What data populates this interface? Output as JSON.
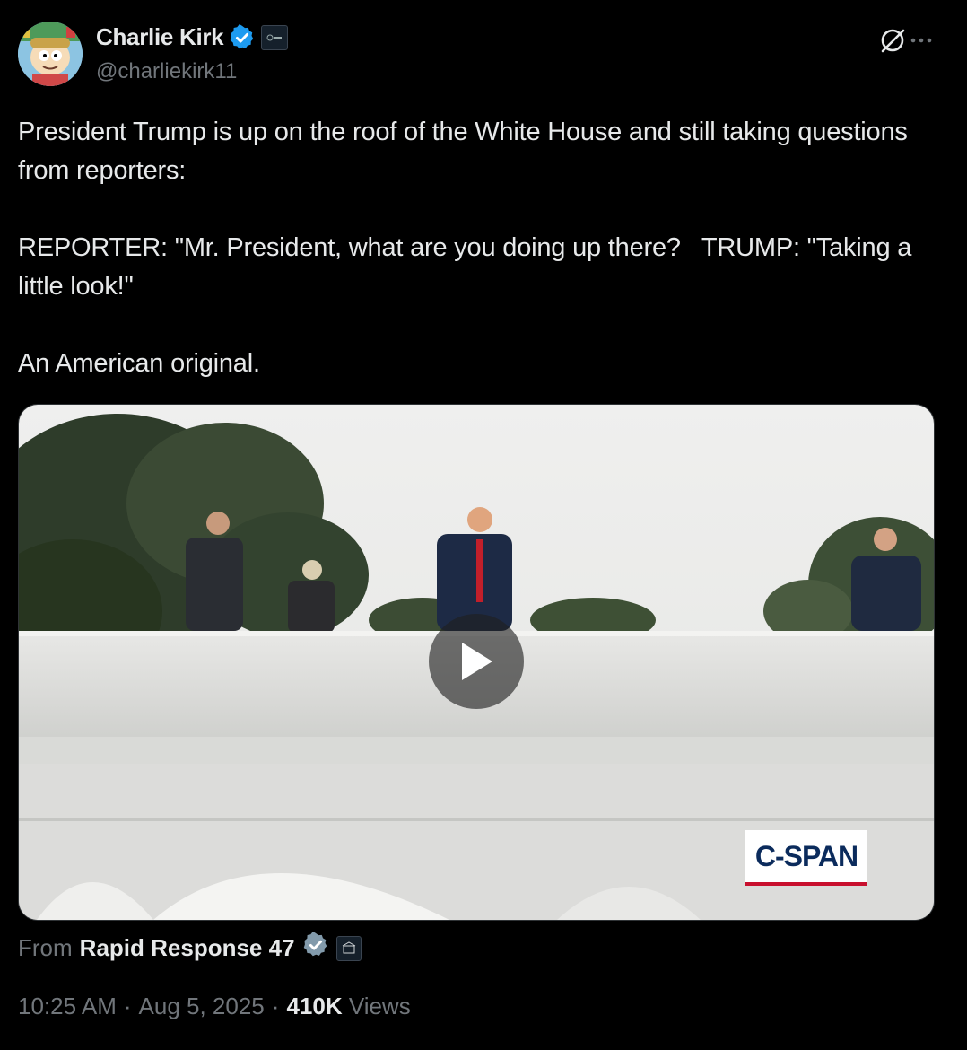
{
  "author": {
    "display_name": "Charlie Kirk",
    "handle": "@charliekirk11",
    "verified_color": "#1d9bf0"
  },
  "tweet": {
    "text": "President Trump is up on the roof of the White House and still taking questions from reporters:\n\nREPORTER: \"Mr. President, what are you doing up there?   TRUMP: \"Taking a little look!\"\n\nAn American original."
  },
  "media": {
    "type": "video",
    "watermark": "C-SPAN"
  },
  "source": {
    "from_label": "From",
    "name": "Rapid Response 47"
  },
  "meta": {
    "time": "10:25 AM",
    "date": "Aug 5, 2025",
    "views_count": "410K",
    "views_label": "Views",
    "separator": "·"
  },
  "icons": [
    "grok-icon",
    "more-icon",
    "verified-badge-icon",
    "play-icon"
  ]
}
